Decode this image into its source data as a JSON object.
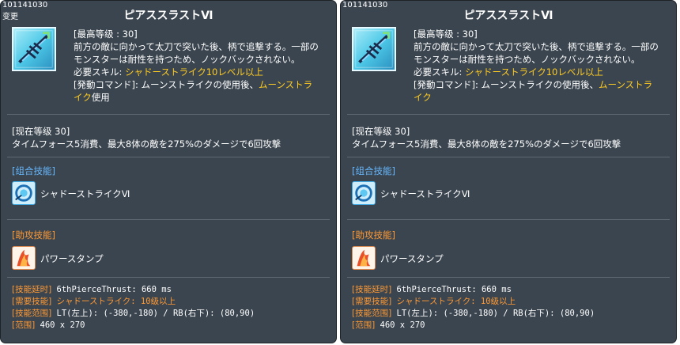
{
  "panels": [
    {
      "id_text": "101141030",
      "status_text": "变更",
      "title": "ピアススラストⅥ",
      "desc": {
        "line1": "[最高等级 : 30]",
        "line2": "前方の敵に向かって太刀で突いた後、柄で追撃する。一部の",
        "line3": "モンスターは耐性を持つため、ノックバックされない。",
        "line4_prefix": "必要スキル: ",
        "line4_hl": "シャドーストライク10レベル以上",
        "line5_prefix": "[発動コマンド]: ムーンストライクの使用後、",
        "line5_hl": "ムーンストラ",
        "line6_hl": "イク",
        "line6_suffix": "使用"
      },
      "current_level": "[现在等级 30]",
      "current_effect": "タイムフォース5消費、最大8体の敵を275%のダメージで6回攻撃",
      "combo_head": "[组合技能]",
      "combo_skill": "シャドーストライクⅥ",
      "assist_head": "[助攻技能]",
      "assist_skill": "パワースタンプ",
      "info": {
        "delay_k": "[技能延时]",
        "delay_v": " 6thPierceThrust: 660 ms",
        "req_k": "[需要技能]",
        "req_v": " シャドーストライク: 10级以上",
        "range_k": "[技能范围]",
        "range_v": " LT(左上): (-380,-180) / RB(右下): (80,90)",
        "area_k": "[范围]",
        "area_v": " 460 x 270"
      }
    },
    {
      "id_text": "101141030",
      "status_text": "",
      "title": "ピアススラストⅥ",
      "desc": {
        "line1": "[最高等级 : 30]",
        "line2": "前方の敵に向かって太刀で突いた後、柄で追撃する。一部の",
        "line3": "モンスターは耐性を持つため、ノックバックされない。",
        "line4_prefix": "必要スキル: ",
        "line4_hl": "シャドーストライク10レベル以上",
        "line5_prefix": "[発動コマンド]: ムーンストライクの使用後、",
        "line5_hl": "ムーンストラ",
        "line6_hl": "イク",
        "line6_suffix": ""
      },
      "current_level": "[现在等级 30]",
      "current_effect": "タイムフォース5消費、最大8体の敵を275%のダメージで6回攻撃",
      "combo_head": "[组合技能]",
      "combo_skill": "シャドーストライクⅥ",
      "assist_head": "[助攻技能]",
      "assist_skill": "パワースタンプ",
      "info": {
        "delay_k": "[技能延时]",
        "delay_v": " 6thPierceThrust: 660 ms",
        "req_k": "[需要技能]",
        "req_v": " シャドーストライク: 10级以上",
        "range_k": "[技能范围]",
        "range_v": " LT(左上): (-380,-180) / RB(右下): (80,90)",
        "area_k": "[范围]",
        "area_v": " 460 x 270"
      }
    }
  ],
  "icons": {
    "main_skill": "pierce-thrust-skill-icon",
    "combo_skill": "shadow-strike-skill-icon",
    "assist_skill": "power-stamp-skill-icon"
  }
}
